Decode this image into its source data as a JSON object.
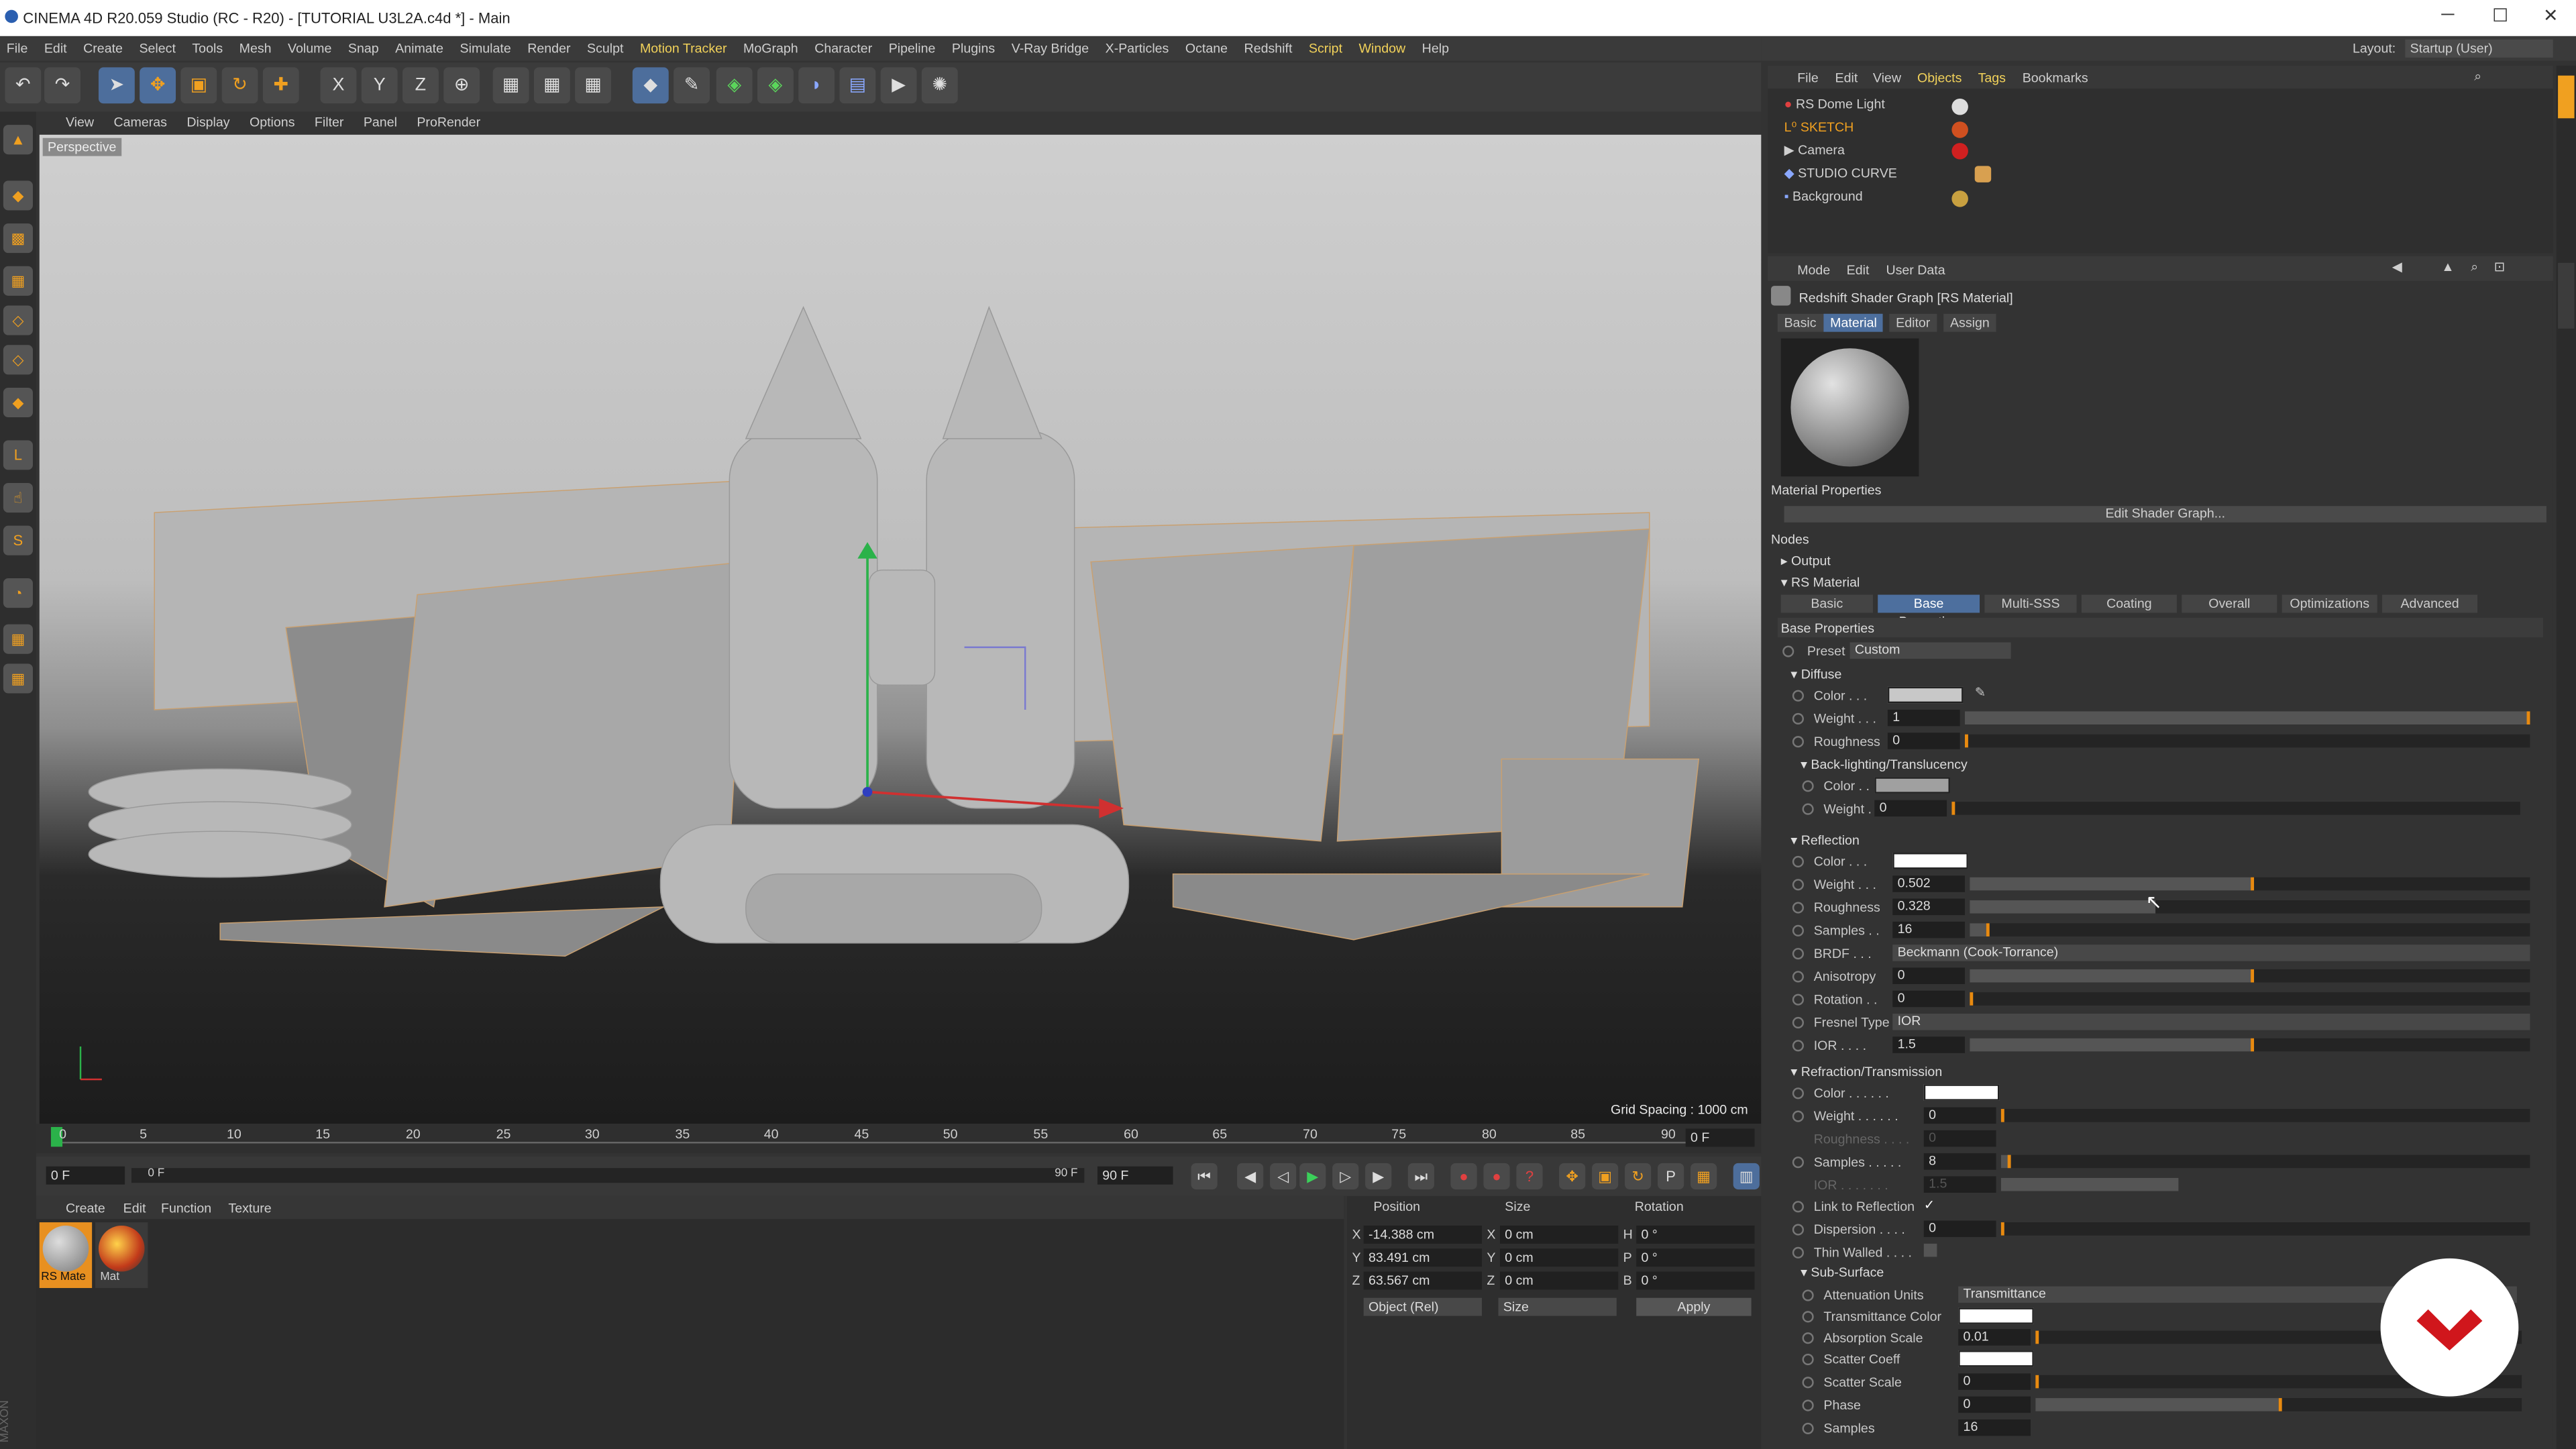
{
  "window": {
    "title": "CINEMA 4D R20.059 Studio (RC - R20) - [TUTORIAL U3L2A.c4d *] - Main",
    "min_icon": "minimize-icon",
    "max_icon": "maximize-icon",
    "close_icon": "close-icon"
  },
  "menu": [
    "File",
    "Edit",
    "Create",
    "Select",
    "Tools",
    "Mesh",
    "Volume",
    "Snap",
    "Animate",
    "Simulate",
    "Render",
    "Sculpt",
    "Motion Tracker",
    "MoGraph",
    "Character",
    "Pipeline",
    "Plugins",
    "V-Ray Bridge",
    "X-Particles",
    "Octane",
    "Redshift",
    "Script",
    "Window",
    "Help"
  ],
  "layout": {
    "label": "Layout:",
    "value": "Startup (User)"
  },
  "viewport": {
    "menu": [
      "View",
      "Cameras",
      "Display",
      "Options",
      "Filter",
      "Panel",
      "ProRender"
    ],
    "label": "Perspective",
    "grid": "Grid Spacing : 1000 cm"
  },
  "timeline": {
    "ticks": [
      "0",
      "5",
      "10",
      "15",
      "20",
      "25",
      "30",
      "35",
      "40",
      "45",
      "50",
      "55",
      "60",
      "65",
      "70",
      "75",
      "80",
      "85",
      "90"
    ],
    "frame_end_field": "0 F",
    "start": "0 F",
    "current": "0 F",
    "end": "90 F",
    "end2": "90 F"
  },
  "materials": {
    "menu": [
      "Create",
      "Edit",
      "Function",
      "Texture"
    ],
    "items": [
      "RS Mate",
      "Mat"
    ]
  },
  "coords": {
    "headers": [
      "Position",
      "Size",
      "Rotation"
    ],
    "rows": [
      {
        "axis": "X",
        "pos": "-14.388 cm",
        "s": "X",
        "size": "0 cm",
        "r": "H",
        "rot": "0 °"
      },
      {
        "axis": "Y",
        "pos": "83.491 cm",
        "s": "Y",
        "size": "0 cm",
        "r": "P",
        "rot": "0 °"
      },
      {
        "axis": "Z",
        "pos": "63.567 cm",
        "s": "Z",
        "size": "0 cm",
        "r": "B",
        "rot": "0 °"
      }
    ],
    "mode": "Object (Rel)",
    "sizemode": "Size",
    "apply": "Apply"
  },
  "objects": {
    "menu": [
      "File",
      "Edit",
      "View",
      "Objects",
      "Tags",
      "Bookmarks"
    ],
    "items": [
      "RS Dome Light",
      "SKETCH",
      "Camera",
      "STUDIO CURVE",
      "Background"
    ]
  },
  "attributes": {
    "menu": [
      "Mode",
      "Edit",
      "User Data"
    ],
    "title": "Redshift Shader Graph [RS Material]",
    "tabs": [
      "Basic",
      "Material",
      "Editor",
      "Assign"
    ],
    "mat_props": "Material Properties",
    "edit_graph": "Edit Shader Graph...",
    "nodes": "Nodes",
    "output": "Output",
    "rs_material": "RS Material",
    "subtabs": [
      "Basic",
      "Base Properties",
      "Multi-SSS",
      "Coating",
      "Overall",
      "Optimizations",
      "Advanced"
    ],
    "base_props": "Base Properties",
    "preset_label": "Preset",
    "preset_value": "Custom",
    "diffuse": {
      "title": "Diffuse",
      "color": "Color . . .",
      "weight": "Weight . . .",
      "weight_v": "1",
      "rough": "Roughness",
      "rough_v": "0"
    },
    "backlight": {
      "title": "Back-lighting/Translucency",
      "color": "Color . .",
      "weight": "Weight .",
      "weight_v": "0"
    },
    "reflection": {
      "title": "Reflection",
      "color": "Color . . .",
      "weight": "Weight . . .",
      "weight_v": "0.502",
      "rough": "Roughness",
      "rough_v": "0.328",
      "samples": "Samples . .",
      "samples_v": "16",
      "brdf": "BRDF . . .",
      "brdf_v": "Beckmann (Cook-Torrance)",
      "aniso": "Anisotropy",
      "aniso_v": "0",
      "rot": "Rotation . .",
      "rot_v": "0",
      "fresnel": "Fresnel Type",
      "fresnel_v": "IOR",
      "ior": "IOR . . . .",
      "ior_v": "1.5"
    },
    "refraction": {
      "title": "Refraction/Transmission",
      "color": "Color . . . . . .",
      "weight": "Weight . . . . . .",
      "weight_v": "0",
      "rough": "Roughness . . . .",
      "rough_v": "0",
      "samples": "Samples . . . . .",
      "samples_v": "8",
      "ior": "IOR . . . . . . .",
      "ior_v": "1.5",
      "link": "Link to Reflection",
      "link_v": "✓",
      "disp": "Dispersion . . . .",
      "disp_v": "0",
      "thin": "Thin Walled . . . ."
    },
    "subsurface": {
      "title": "Sub-Surface",
      "atten": "Attenuation Units",
      "atten_v": "Transmittance",
      "tcolor": "Transmittance Color",
      "abs": "Absorption Scale",
      "abs_v": "0.01",
      "scoeff": "Scatter Coeff",
      "sscale": "Scatter Scale",
      "sscale_v": "0",
      "phase": "Phase",
      "phase_v": "0",
      "samples": "Samples",
      "samples_v": "16"
    }
  },
  "colors": {
    "accent": "#4d6f9e",
    "slider_mark": "#e88a10",
    "highlight_menu": "#f2d25a"
  }
}
